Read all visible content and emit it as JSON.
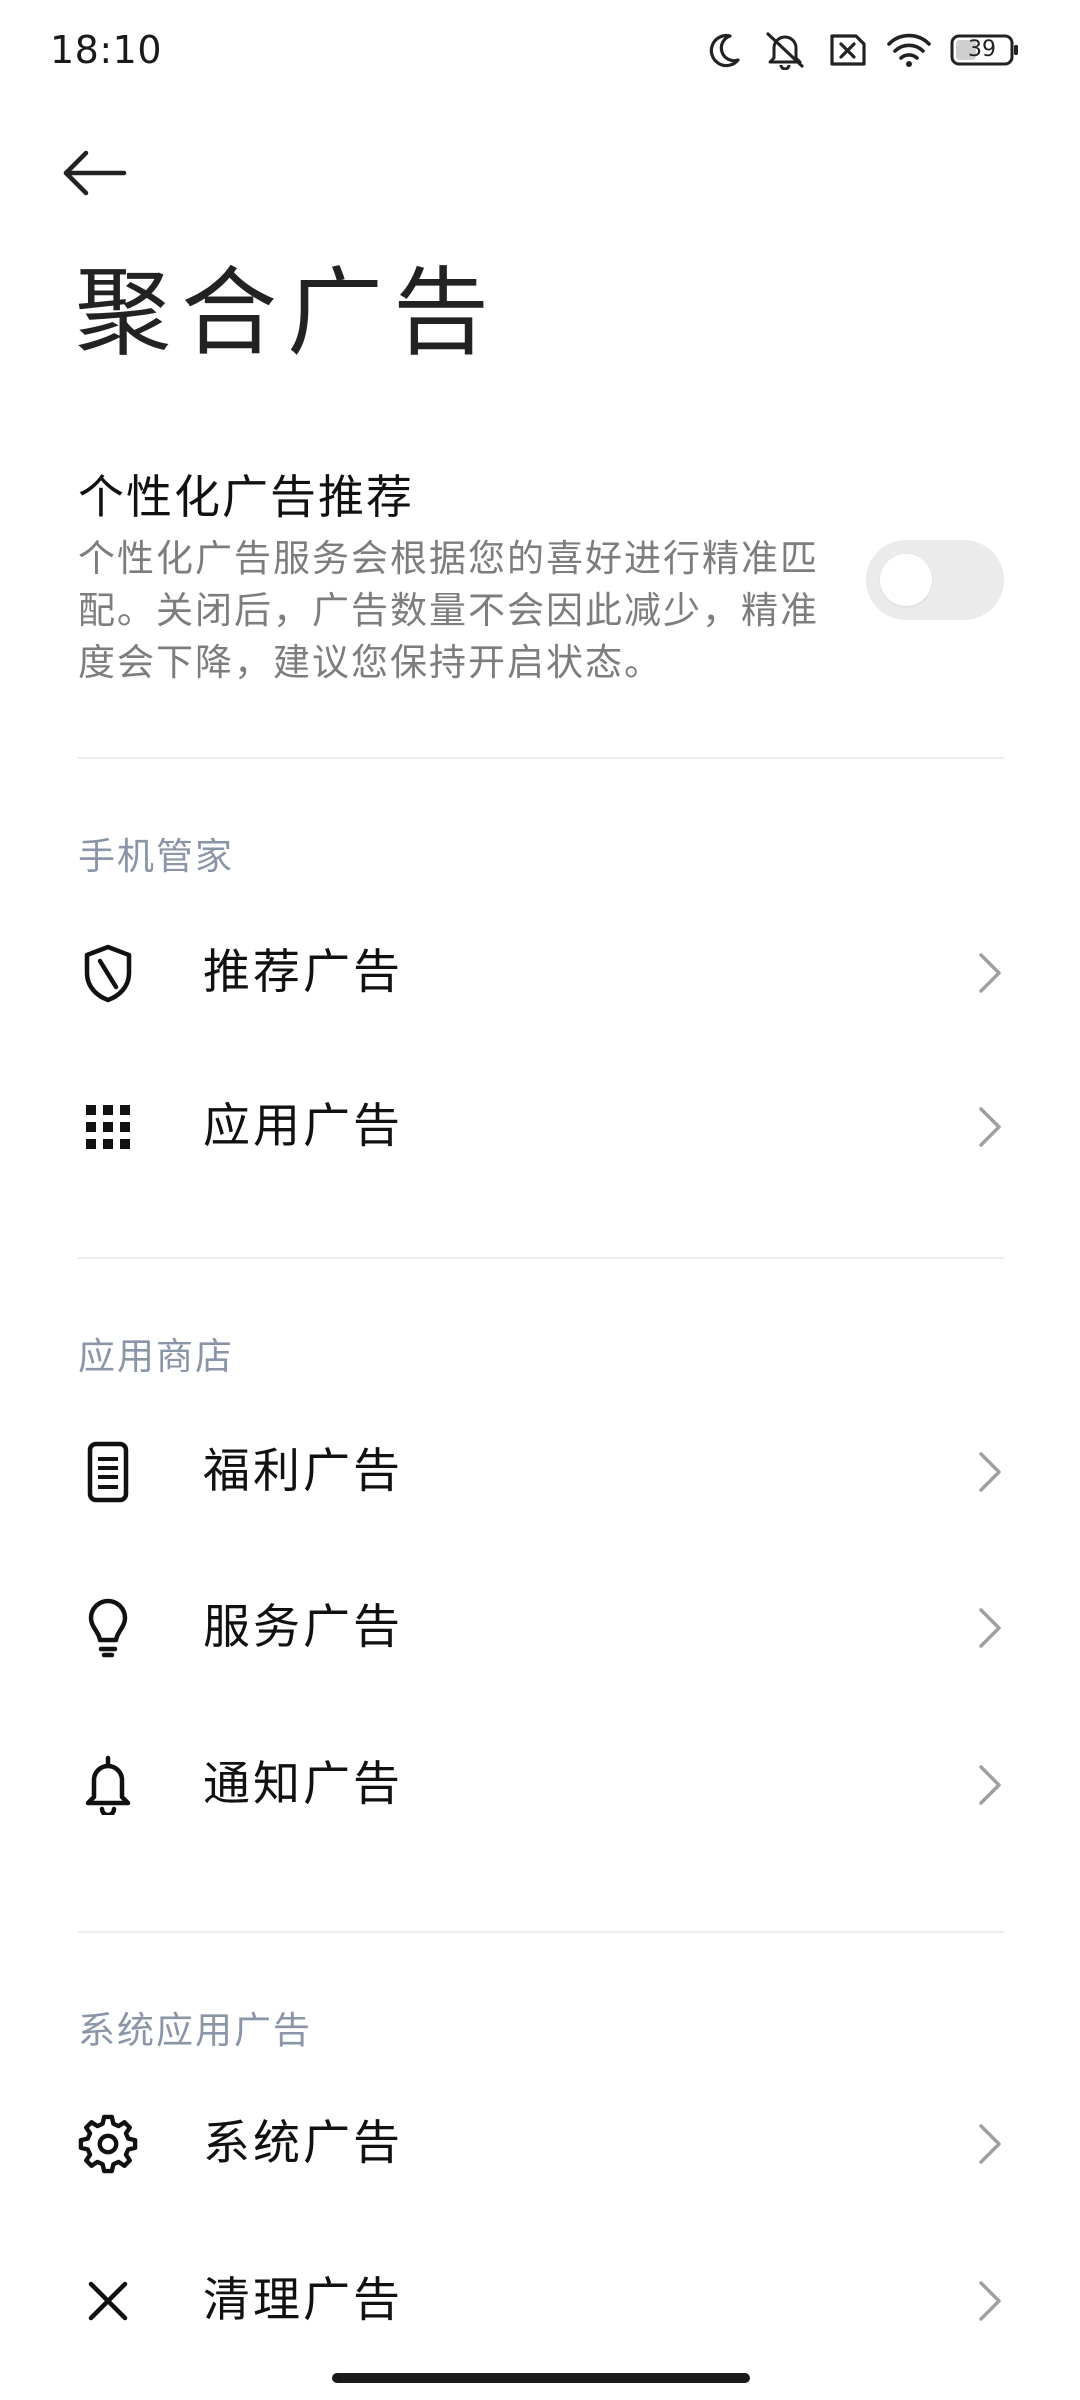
{
  "status_bar": {
    "time": "18:10",
    "battery": "39",
    "icons": [
      "moon-icon",
      "mute-icon",
      "sim-error-icon",
      "wifi-icon",
      "battery-icon"
    ]
  },
  "header": {
    "back_icon": "arrow-left-icon",
    "title": "聚合广告"
  },
  "personalized": {
    "title": "个性化广告推荐",
    "description": "个性化广告服务会根据您的喜好进行精准匹配。关闭后，广告数量不会因此减少，精准度会下降，建议您保持开启状态。",
    "enabled": false
  },
  "sections": [
    {
      "header": "手机管家",
      "items": [
        {
          "label": "推荐广告",
          "icon": "shield-icon"
        },
        {
          "label": "应用广告",
          "icon": "apps-grid-icon"
        }
      ]
    },
    {
      "header": "应用商店",
      "items": [
        {
          "label": "福利广告",
          "icon": "phone-doc-icon"
        },
        {
          "label": "服务广告",
          "icon": "lightbulb-icon"
        },
        {
          "label": "通知广告",
          "icon": "bell-icon"
        }
      ]
    },
    {
      "header": "系统应用广告",
      "items": [
        {
          "label": "系统广告",
          "icon": "gear-icon"
        },
        {
          "label": "清理广告",
          "icon": "close-icon"
        }
      ]
    }
  ],
  "colors": {
    "section_header": "#8a95a8",
    "description": "#7d7d7d",
    "toggle_track": "#ebebeb",
    "chevron": "#a0a0a0"
  }
}
